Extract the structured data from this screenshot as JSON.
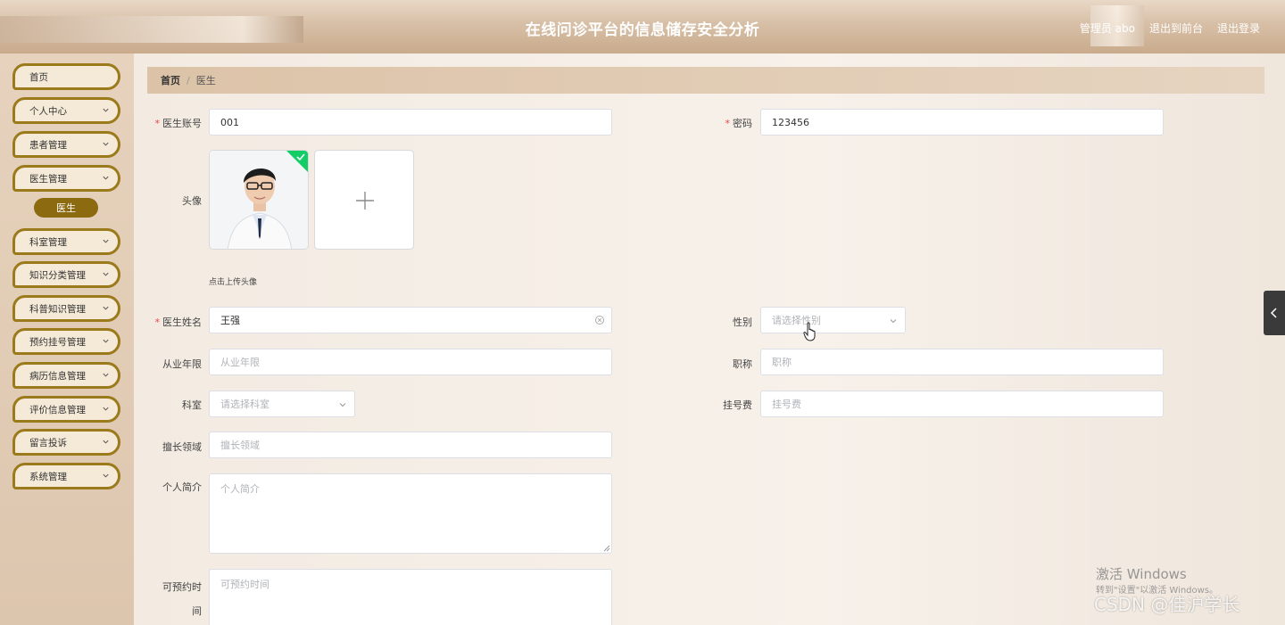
{
  "header": {
    "title": "在线问诊平台的信息储存安全分析",
    "admin": "管理员 abo",
    "front": "退出到前台",
    "logout": "退出登录"
  },
  "sidebar": {
    "items": [
      {
        "label": "首页"
      },
      {
        "label": "个人中心"
      },
      {
        "label": "患者管理"
      },
      {
        "label": "医生管理"
      },
      {
        "label": "科室管理"
      },
      {
        "label": "知识分类管理"
      },
      {
        "label": "科普知识管理"
      },
      {
        "label": "预约挂号管理"
      },
      {
        "label": "病历信息管理"
      },
      {
        "label": "评价信息管理"
      },
      {
        "label": "留言投诉"
      },
      {
        "label": "系统管理"
      }
    ],
    "active_sub": "医生"
  },
  "breadcrumb": {
    "home": "首页",
    "sep": "/",
    "current": "医生"
  },
  "form": {
    "account": {
      "label": "医生账号",
      "value": "001"
    },
    "password": {
      "label": "密码",
      "value": "123456"
    },
    "avatar": {
      "label": "头像",
      "hint": "点击上传头像"
    },
    "name": {
      "label": "医生姓名",
      "value": "王强"
    },
    "gender": {
      "label": "性别",
      "placeholder": "请选择性别"
    },
    "years": {
      "label": "从业年限",
      "placeholder": "从业年限"
    },
    "title": {
      "label": "职称",
      "placeholder": "职称"
    },
    "dept": {
      "label": "科室",
      "placeholder": "请选择科室"
    },
    "fee": {
      "label": "挂号费",
      "placeholder": "挂号费"
    },
    "specialty": {
      "label": "擅长领域",
      "placeholder": "擅长领域"
    },
    "intro": {
      "label": "个人简介",
      "placeholder": "个人简介"
    },
    "schedule": {
      "label_1": "可预约时",
      "label_2": "间",
      "placeholder": "可预约时间"
    }
  },
  "overlay": {
    "activate_title": "激活 Windows",
    "activate_sub": "转到\"设置\"以激活 Windows。",
    "csdn": "CSDN @佳沪学长"
  },
  "colors": {
    "accent": "#8b6a10",
    "menu_border": "#9a7a1a"
  }
}
